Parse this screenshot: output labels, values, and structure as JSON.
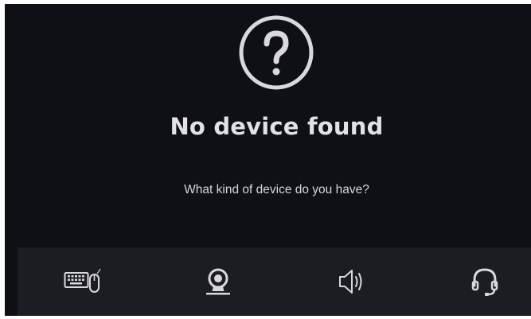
{
  "message": {
    "icon": "question-circle-icon",
    "title": "No device found",
    "subtitle": "What kind of device do you have?"
  },
  "device_types": [
    {
      "id": "keyboard-mouse",
      "icon": "keyboard-mouse-icon"
    },
    {
      "id": "webcam",
      "icon": "webcam-icon"
    },
    {
      "id": "speaker",
      "icon": "speaker-icon"
    },
    {
      "id": "headset",
      "icon": "headset-icon"
    }
  ],
  "colors": {
    "background": "#0e1016",
    "bar": "#1b1d23",
    "text": "#e2e2e4",
    "icon": "#d9d9dc"
  }
}
